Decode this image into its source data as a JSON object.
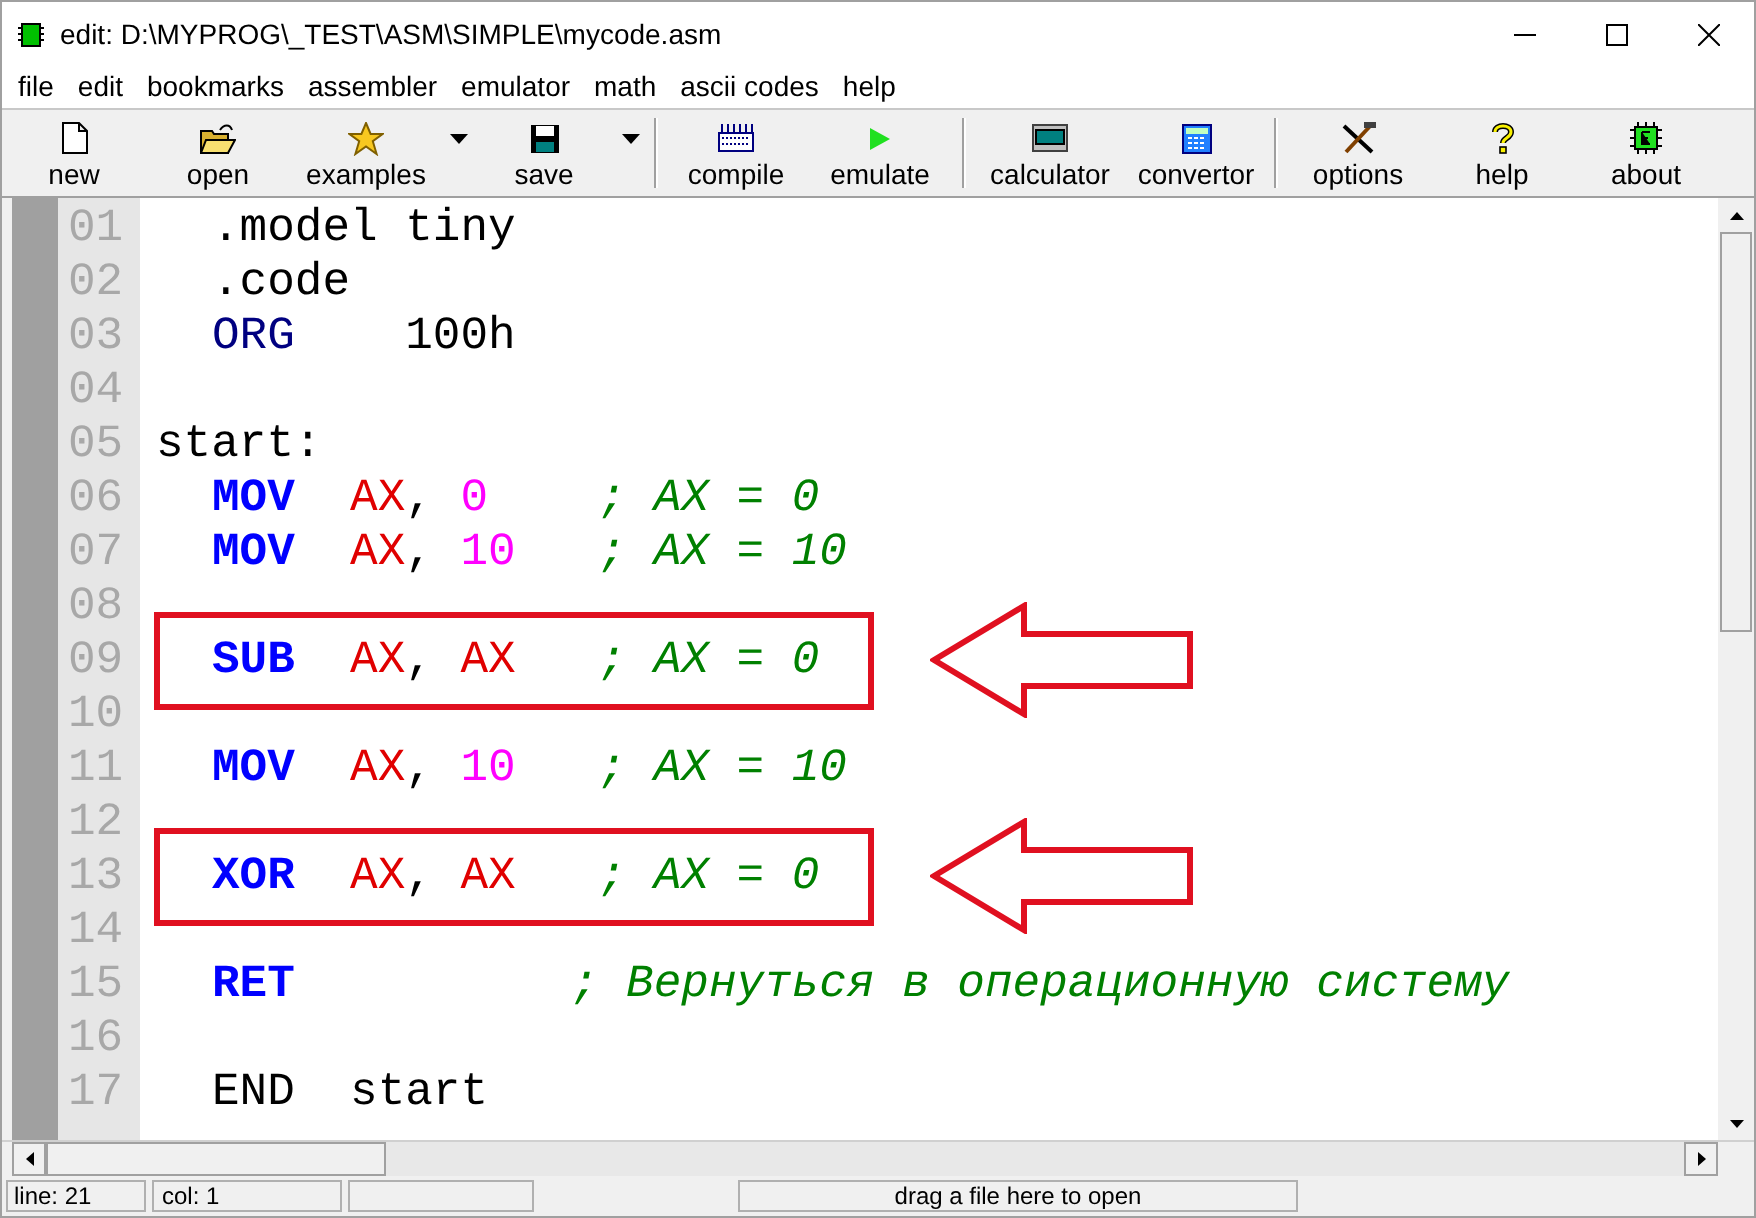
{
  "window": {
    "title": "edit: D:\\MYPROG\\_TEST\\ASM\\SIMPLE\\mycode.asm"
  },
  "menu": [
    "file",
    "edit",
    "bookmarks",
    "assembler",
    "emulator",
    "math",
    "ascii codes",
    "help"
  ],
  "toolbar": [
    {
      "kind": "new",
      "label": "new",
      "dropdown": false,
      "separator_before": false
    },
    {
      "kind": "open",
      "label": "open",
      "dropdown": false,
      "separator_before": false
    },
    {
      "kind": "examples",
      "label": "examples",
      "dropdown": true,
      "separator_before": false
    },
    {
      "kind": "save",
      "label": "save",
      "dropdown": true,
      "separator_before": false
    },
    {
      "kind": "compile",
      "label": "compile",
      "dropdown": false,
      "separator_before": true
    },
    {
      "kind": "emulate",
      "label": "emulate",
      "dropdown": false,
      "separator_before": false
    },
    {
      "kind": "calculator",
      "label": "calculator",
      "dropdown": false,
      "separator_before": true
    },
    {
      "kind": "convertor",
      "label": "convertor",
      "dropdown": false,
      "separator_before": false
    },
    {
      "kind": "options",
      "label": "options",
      "dropdown": false,
      "separator_before": true
    },
    {
      "kind": "help",
      "label": "help",
      "dropdown": false,
      "separator_before": false
    },
    {
      "kind": "about",
      "label": "about",
      "dropdown": false,
      "separator_before": false
    }
  ],
  "editor": {
    "lines": [
      {
        "number": "01",
        "indented": true,
        "highlighted": false,
        "tokens": [
          {
            "kind": "plain",
            "text": ".model tiny"
          }
        ]
      },
      {
        "number": "02",
        "indented": true,
        "highlighted": false,
        "tokens": [
          {
            "kind": "plain",
            "text": ".code"
          }
        ]
      },
      {
        "number": "03",
        "indented": true,
        "highlighted": false,
        "tokens": [
          {
            "kind": "directive",
            "text": "ORG    "
          },
          {
            "kind": "plain",
            "text": "100h"
          }
        ]
      },
      {
        "number": "04",
        "highlighted": false
      },
      {
        "number": "05",
        "indented": false,
        "highlighted": false,
        "tokens": [
          {
            "kind": "plain",
            "text": "start:"
          }
        ]
      },
      {
        "number": "06",
        "indented": true,
        "highlighted": false,
        "tokens": [
          {
            "kind": "keyword",
            "text": "MOV  "
          },
          {
            "kind": "register",
            "text": "AX"
          },
          {
            "kind": "plain",
            "text": ", "
          },
          {
            "kind": "number",
            "text": "0    "
          },
          {
            "kind": "comment",
            "text": "; AX = 0"
          }
        ]
      },
      {
        "number": "07",
        "indented": true,
        "highlighted": false,
        "tokens": [
          {
            "kind": "keyword",
            "text": "MOV  "
          },
          {
            "kind": "register",
            "text": "AX"
          },
          {
            "kind": "plain",
            "text": ", "
          },
          {
            "kind": "number",
            "text": "10   "
          },
          {
            "kind": "comment",
            "text": "; AX = 10"
          }
        ]
      },
      {
        "number": "08",
        "highlighted": false
      },
      {
        "number": "09",
        "indented": true,
        "highlighted": true,
        "tokens": [
          {
            "kind": "keyword",
            "text": "SUB  "
          },
          {
            "kind": "register",
            "text": "AX"
          },
          {
            "kind": "plain",
            "text": ", "
          },
          {
            "kind": "register",
            "text": "AX   "
          },
          {
            "kind": "comment",
            "text": "; AX = 0"
          }
        ]
      },
      {
        "number": "10",
        "highlighted": false
      },
      {
        "number": "11",
        "indented": true,
        "highlighted": false,
        "tokens": [
          {
            "kind": "keyword",
            "text": "MOV  "
          },
          {
            "kind": "register",
            "text": "AX"
          },
          {
            "kind": "plain",
            "text": ", "
          },
          {
            "kind": "number",
            "text": "10   "
          },
          {
            "kind": "comment",
            "text": "; AX = 10"
          }
        ]
      },
      {
        "number": "12",
        "highlighted": false
      },
      {
        "number": "13",
        "indented": true,
        "highlighted": true,
        "tokens": [
          {
            "kind": "keyword",
            "text": "XOR  "
          },
          {
            "kind": "register",
            "text": "AX"
          },
          {
            "kind": "plain",
            "text": ", "
          },
          {
            "kind": "register",
            "text": "AX   "
          },
          {
            "kind": "comment",
            "text": "; AX = 0"
          }
        ]
      },
      {
        "number": "14",
        "highlighted": false
      },
      {
        "number": "15",
        "indented": true,
        "highlighted": false,
        "tokens": [
          {
            "kind": "keyword",
            "text": "RET          "
          },
          {
            "kind": "comment",
            "text": "; Вернуться в операционную систему"
          }
        ]
      },
      {
        "number": "16",
        "highlighted": false
      },
      {
        "number": "17",
        "indented": true,
        "highlighted": false,
        "tokens": [
          {
            "kind": "plain",
            "text": "END  start"
          }
        ]
      }
    ]
  },
  "status_bar": {
    "line": "line: 21",
    "col": "col: 1",
    "hint": "drag a file here to open"
  }
}
